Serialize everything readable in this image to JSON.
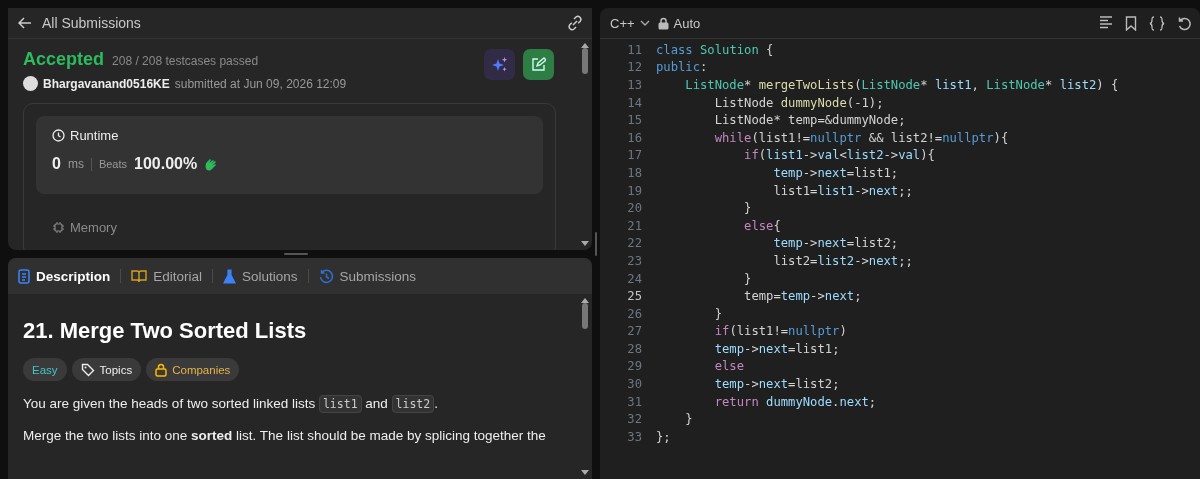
{
  "submission_panel": {
    "back_label": "All Submissions",
    "status": "Accepted",
    "testcases": "208 / 208 testcases passed",
    "user": "Bhargavanand0516KE",
    "submitted": "submitted at Jun 09, 2026 12:09",
    "runtime": {
      "title": "Runtime",
      "value": "0",
      "unit": "ms",
      "beats_label": "Beats",
      "beats": "100.00%"
    },
    "memory": {
      "title": "Memory"
    }
  },
  "problem_panel": {
    "tabs": [
      {
        "label": "Description",
        "selected": true,
        "kind": "description"
      },
      {
        "label": "Editorial",
        "selected": false,
        "kind": "editorial"
      },
      {
        "label": "Solutions",
        "selected": false,
        "kind": "solutions"
      },
      {
        "label": "Submissions",
        "selected": false,
        "kind": "submissions"
      }
    ],
    "title": "21. Merge Two Sorted Lists",
    "tags": [
      {
        "label": "Easy",
        "kind": "difficulty"
      },
      {
        "label": "Topics",
        "kind": "topics"
      },
      {
        "label": "Companies",
        "kind": "companies"
      }
    ],
    "intro": [
      {
        "text": "You are given the heads of two sorted linked lists ",
        "kind": "text"
      },
      {
        "text": "list1",
        "kind": "code"
      },
      {
        "text": " and ",
        "kind": "text"
      },
      {
        "text": "list2",
        "kind": "code"
      },
      {
        "text": ".",
        "kind": "text"
      }
    ],
    "paragraph": "Merge the two lists into one **sorted** list. The list should be made by splicing together the"
  },
  "editor": {
    "language": "C++",
    "mode": "Auto",
    "lines": [
      {
        "number": "11",
        "current": false,
        "tokens": [
          {
            "text": "class ",
            "kind": "kw"
          },
          {
            "text": "Solution",
            "kind": "type"
          },
          {
            "text": " {",
            "kind": "p"
          }
        ]
      },
      {
        "number": "12",
        "current": false,
        "tokens": [
          {
            "text": "public",
            "kind": "kw"
          },
          {
            "text": ":",
            "kind": "p"
          }
        ]
      },
      {
        "number": "13",
        "current": false,
        "tokens": [
          {
            "text": "    ListNode",
            "kind": "type"
          },
          {
            "text": "* ",
            "kind": "p"
          },
          {
            "text": "mergeTwoLists",
            "kind": "fn"
          },
          {
            "text": "(",
            "kind": "p"
          },
          {
            "text": "ListNode",
            "kind": "type"
          },
          {
            "text": "* ",
            "kind": "p"
          },
          {
            "text": "list1",
            "kind": "var"
          },
          {
            "text": ", ",
            "kind": "p"
          },
          {
            "text": "ListNode",
            "kind": "type"
          },
          {
            "text": "* ",
            "kind": "p"
          },
          {
            "text": "list2",
            "kind": "var"
          },
          {
            "text": ") {",
            "kind": "p"
          }
        ]
      },
      {
        "number": "14",
        "current": false,
        "tokens": [
          {
            "text": "        ListNode ",
            "kind": "p"
          },
          {
            "text": "dummyNode",
            "kind": "fn"
          },
          {
            "text": "(-1);",
            "kind": "p"
          }
        ]
      },
      {
        "number": "15",
        "current": false,
        "tokens": [
          {
            "text": "        ListNode* temp=&dummyNode;",
            "kind": "p"
          }
        ]
      },
      {
        "number": "16",
        "current": false,
        "tokens": [
          {
            "text": "        while",
            "kind": "ctl"
          },
          {
            "text": "(list1!=",
            "kind": "p"
          },
          {
            "text": "nullptr",
            "kind": "kw"
          },
          {
            "text": " && list2!=",
            "kind": "p"
          },
          {
            "text": "nullptr",
            "kind": "kw"
          },
          {
            "text": "){",
            "kind": "p"
          }
        ]
      },
      {
        "number": "17",
        "current": false,
        "tokens": [
          {
            "text": "            if",
            "kind": "ctl"
          },
          {
            "text": "(",
            "kind": "p"
          },
          {
            "text": "list1",
            "kind": "var"
          },
          {
            "text": "->",
            "kind": "p"
          },
          {
            "text": "val",
            "kind": "var"
          },
          {
            "text": "<",
            "kind": "p"
          },
          {
            "text": "list2",
            "kind": "var"
          },
          {
            "text": "->",
            "kind": "p"
          },
          {
            "text": "val",
            "kind": "var"
          },
          {
            "text": "){",
            "kind": "p"
          }
        ]
      },
      {
        "number": "18",
        "current": false,
        "tokens": [
          {
            "text": "                temp",
            "kind": "var"
          },
          {
            "text": "->",
            "kind": "p"
          },
          {
            "text": "next",
            "kind": "var"
          },
          {
            "text": "=list1;",
            "kind": "p"
          }
        ]
      },
      {
        "number": "19",
        "current": false,
        "tokens": [
          {
            "text": "                list1=",
            "kind": "p"
          },
          {
            "text": "list1",
            "kind": "var"
          },
          {
            "text": "->",
            "kind": "p"
          },
          {
            "text": "next",
            "kind": "var"
          },
          {
            "text": ";;",
            "kind": "p"
          }
        ]
      },
      {
        "number": "20",
        "current": false,
        "tokens": [
          {
            "text": "            }",
            "kind": "p"
          }
        ]
      },
      {
        "number": "21",
        "current": false,
        "tokens": [
          {
            "text": "            else",
            "kind": "ctl"
          },
          {
            "text": "{",
            "kind": "p"
          }
        ]
      },
      {
        "number": "22",
        "current": false,
        "tokens": [
          {
            "text": "                temp",
            "kind": "var"
          },
          {
            "text": "->",
            "kind": "p"
          },
          {
            "text": "next",
            "kind": "var"
          },
          {
            "text": "=list2;",
            "kind": "p"
          }
        ]
      },
      {
        "number": "23",
        "current": false,
        "tokens": [
          {
            "text": "                list2=",
            "kind": "p"
          },
          {
            "text": "list2",
            "kind": "var"
          },
          {
            "text": "->",
            "kind": "p"
          },
          {
            "text": "next",
            "kind": "var"
          },
          {
            "text": ";;",
            "kind": "p"
          }
        ]
      },
      {
        "number": "24",
        "current": false,
        "tokens": [
          {
            "text": "            }",
            "kind": "p"
          }
        ]
      },
      {
        "number": "25",
        "current": true,
        "tokens": [
          {
            "text": "            temp=",
            "kind": "p"
          },
          {
            "text": "temp",
            "kind": "var"
          },
          {
            "text": "->",
            "kind": "p"
          },
          {
            "text": "next",
            "kind": "var"
          },
          {
            "text": ";",
            "kind": "p"
          }
        ]
      },
      {
        "number": "26",
        "current": false,
        "tokens": [
          {
            "text": "        }",
            "kind": "p"
          }
        ]
      },
      {
        "number": "27",
        "current": false,
        "tokens": [
          {
            "text": "        if",
            "kind": "ctl"
          },
          {
            "text": "(list1!=",
            "kind": "p"
          },
          {
            "text": "nullptr",
            "kind": "kw"
          },
          {
            "text": ")",
            "kind": "p"
          }
        ]
      },
      {
        "number": "28",
        "current": false,
        "tokens": [
          {
            "text": "        temp",
            "kind": "var"
          },
          {
            "text": "->",
            "kind": "p"
          },
          {
            "text": "next",
            "kind": "var"
          },
          {
            "text": "=list1;",
            "kind": "p"
          }
        ]
      },
      {
        "number": "29",
        "current": false,
        "tokens": [
          {
            "text": "        else",
            "kind": "ctl"
          }
        ]
      },
      {
        "number": "30",
        "current": false,
        "tokens": [
          {
            "text": "        temp",
            "kind": "var"
          },
          {
            "text": "->",
            "kind": "p"
          },
          {
            "text": "next",
            "kind": "var"
          },
          {
            "text": "=list2;",
            "kind": "p"
          }
        ]
      },
      {
        "number": "31",
        "current": false,
        "tokens": [
          {
            "text": "        return",
            "kind": "ctl"
          },
          {
            "text": " dummyNode",
            "kind": "var"
          },
          {
            "text": ".",
            "kind": "p"
          },
          {
            "text": "next",
            "kind": "var"
          },
          {
            "text": ";",
            "kind": "p"
          }
        ]
      },
      {
        "number": "32",
        "current": false,
        "tokens": [
          {
            "text": "    }",
            "kind": "p"
          }
        ]
      },
      {
        "number": "33",
        "current": false,
        "tokens": [
          {
            "text": "};",
            "kind": "p"
          }
        ]
      }
    ]
  }
}
